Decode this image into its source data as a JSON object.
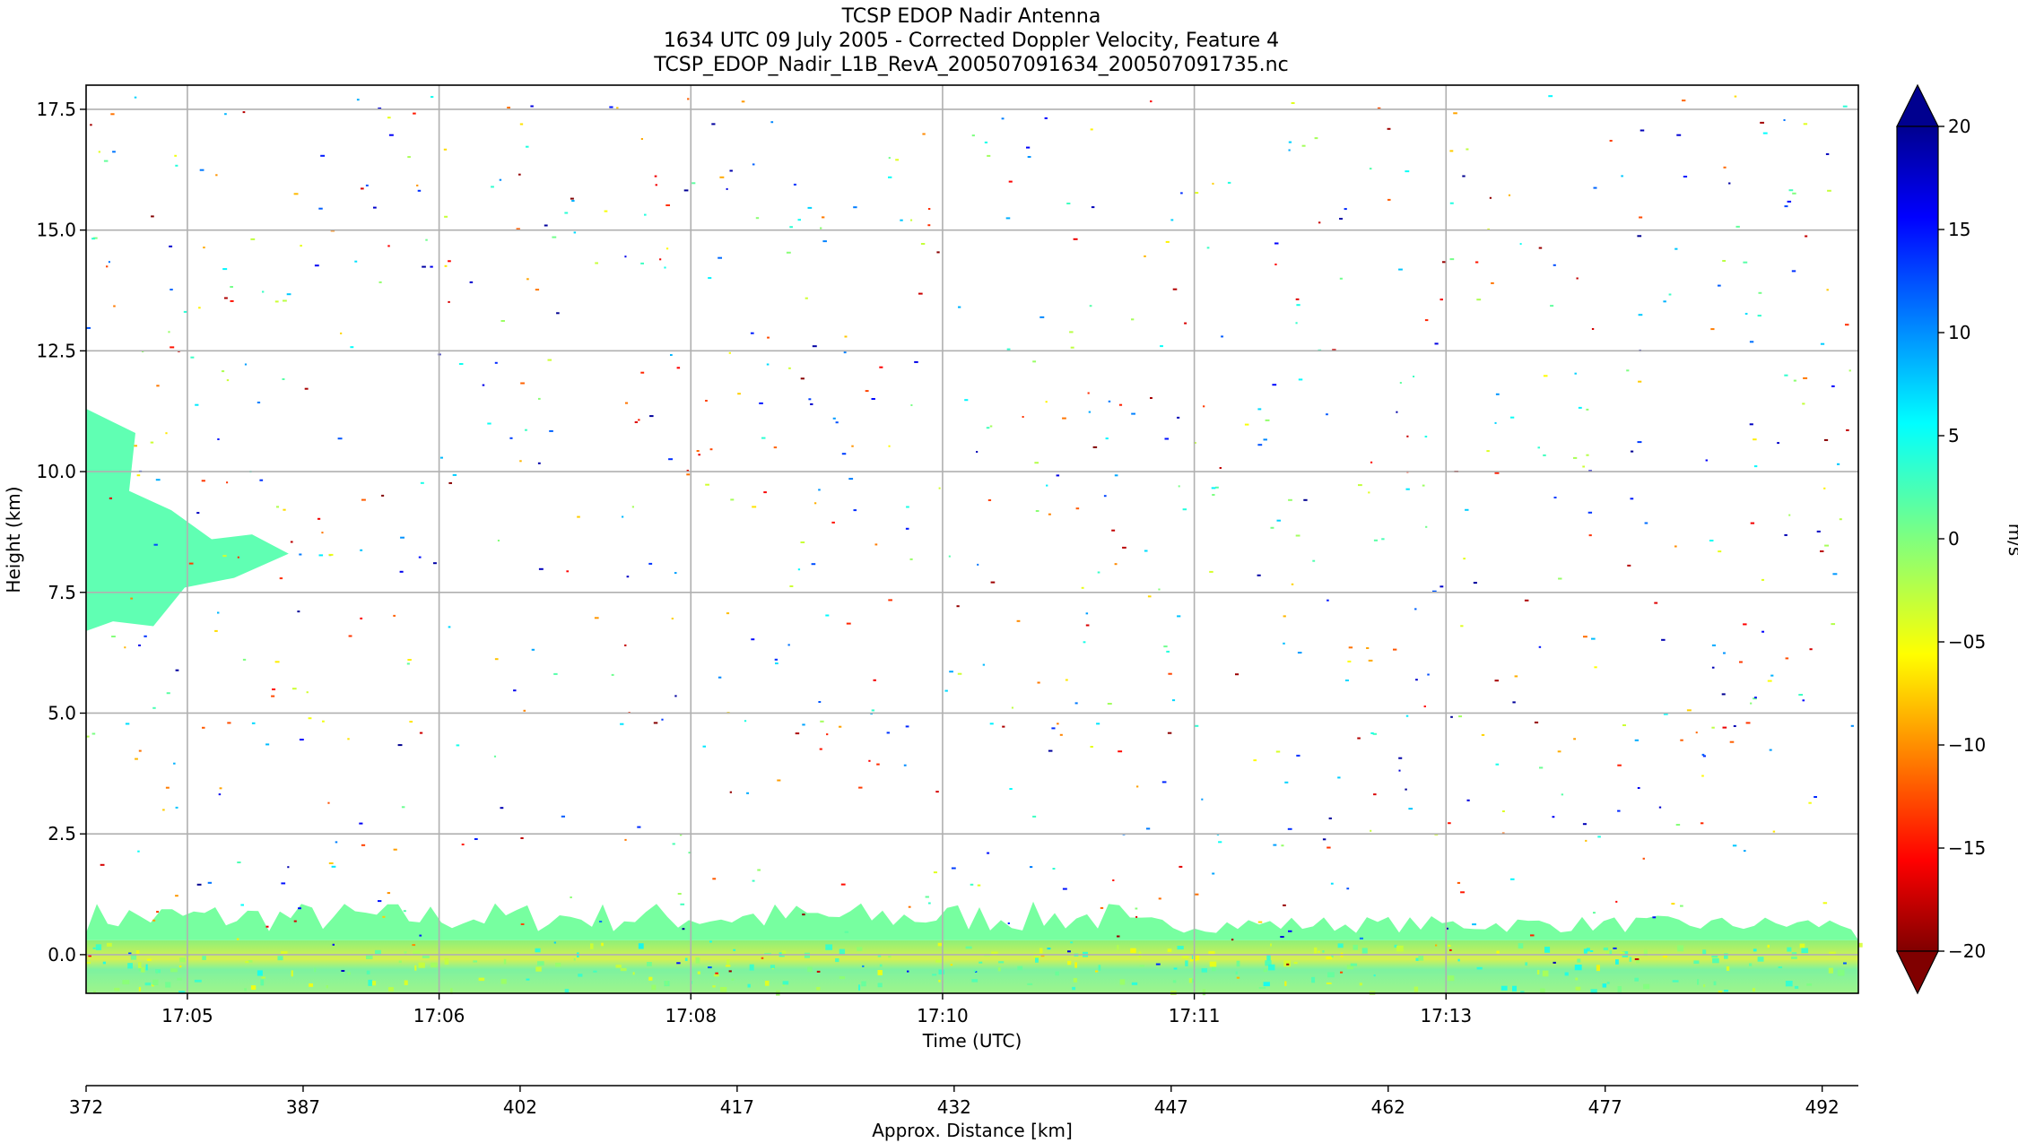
{
  "chart_data": {
    "type": "heatmap",
    "title_lines": [
      "TCSP EDOP Nadir Antenna",
      "1634 UTC 09 July 2005 - Corrected Doppler Velocity, Feature 4",
      "TCSP_EDOP_Nadir_L1B_RevA_200507091634_200507091735.nc"
    ],
    "xlabel": "Time (UTC)",
    "ylabel": "Height (km)",
    "x2label": "Approx. Distance [km]",
    "ylim": [
      -0.8,
      18.0
    ],
    "x_time_ticks": [
      "17:05",
      "17:06",
      "17:08",
      "17:10",
      "17:11",
      "17:13"
    ],
    "x_distance_range": [
      372,
      494.5
    ],
    "x_distance_ticks": [
      372,
      387,
      402,
      417,
      432,
      447,
      462,
      477,
      492
    ],
    "y_ticks": [
      0.0,
      2.5,
      5.0,
      7.5,
      10.0,
      12.5,
      15.0,
      17.5
    ],
    "y_tick_labels": [
      "0.0",
      "2.5",
      "5.0",
      "7.5",
      "10.0",
      "12.5",
      "15.0",
      "17.5"
    ],
    "grid": true,
    "colorbar": {
      "label": "m/s",
      "range": [
        -20,
        20
      ],
      "extend": "both",
      "ticks": [
        20,
        15,
        10,
        5,
        0,
        -5,
        -10,
        -15,
        -20
      ],
      "tick_labels": [
        "20",
        "15",
        "10",
        "5",
        "0",
        "−05",
        "−10",
        "−15",
        "−20"
      ],
      "colormap": "jet"
    },
    "features": [
      {
        "name": "surface band",
        "height_range_km": [
          -0.8,
          0.3
        ],
        "velocity_ms": 0
      },
      {
        "name": "low cloud layer",
        "height_range_km": [
          0.3,
          1.1
        ],
        "velocity_ms": 1
      },
      {
        "name": "mid-level cloud",
        "distance_range_km": [
          372,
          386
        ],
        "height_range_km": [
          6.7,
          11.3
        ],
        "velocity_ms": 2
      }
    ],
    "colors": {
      "low": "#800000",
      "mid": "#7fff7f",
      "high": "#00008f",
      "grid": "#b0b0b0"
    }
  }
}
